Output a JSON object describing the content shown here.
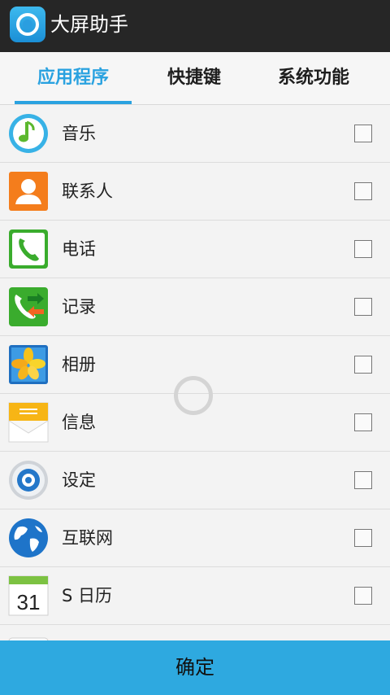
{
  "app": {
    "title": "大屏助手"
  },
  "tabs": [
    {
      "label": "应用程序",
      "active": true
    },
    {
      "label": "快捷键"
    },
    {
      "label": "系统功能"
    }
  ],
  "items": [
    {
      "label": "音乐",
      "icon": "music-icon",
      "checked": false
    },
    {
      "label": "联系人",
      "icon": "contacts-icon",
      "checked": false
    },
    {
      "label": "电话",
      "icon": "phone-icon",
      "checked": false
    },
    {
      "label": "记录",
      "icon": "call-log-icon",
      "checked": false
    },
    {
      "label": "相册",
      "icon": "gallery-icon",
      "checked": false
    },
    {
      "label": "信息",
      "icon": "messages-icon",
      "checked": false
    },
    {
      "label": "设定",
      "icon": "settings-icon",
      "checked": false
    },
    {
      "label": "互联网",
      "icon": "internet-icon",
      "checked": false
    },
    {
      "label": "S 日历",
      "icon": "calendar-icon",
      "checked": false,
      "calendar_day": "31"
    }
  ],
  "footer": {
    "confirm_label": "确定"
  },
  "colors": {
    "accent": "#2aa2e0",
    "titlebar": "#262626",
    "button": "#2ea9e0"
  }
}
